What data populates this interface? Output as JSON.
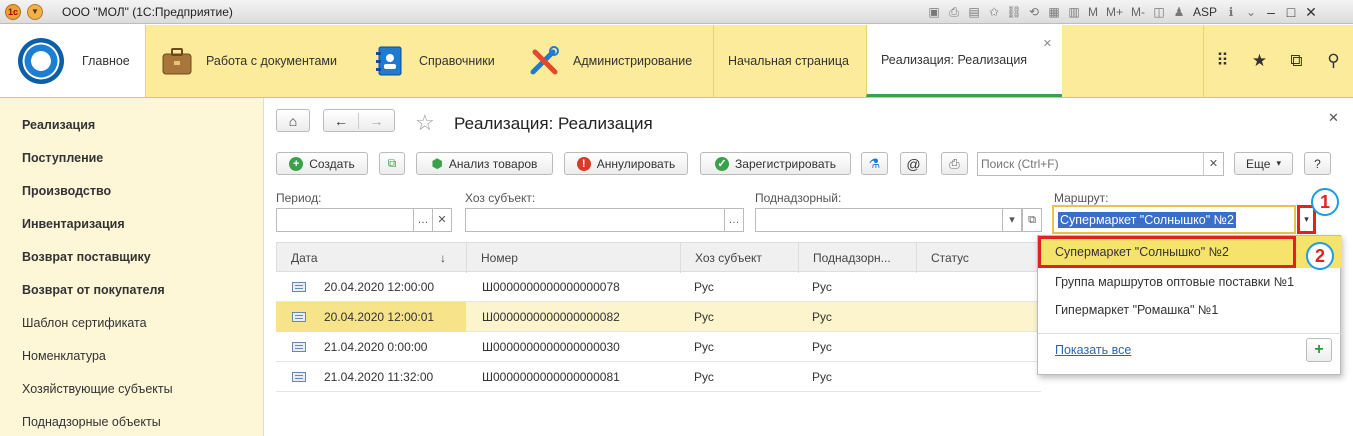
{
  "window": {
    "title": "ООО \"МОЛ\" (1С:Предприятие)",
    "user": "ASP",
    "toolbar_letters": [
      "M",
      "M+",
      "M-"
    ]
  },
  "sections": {
    "home": "Главное",
    "docs": "Работа с документами",
    "refs": "Справочники",
    "admin": "Администрирование"
  },
  "tabs": {
    "start": "Начальная страница",
    "active": "Реализация: Реализация"
  },
  "sidebar": {
    "items": [
      {
        "label": "Реализация",
        "bold": true
      },
      {
        "label": "Поступление",
        "bold": true
      },
      {
        "label": "Производство",
        "bold": true
      },
      {
        "label": "Инвентаризация",
        "bold": true
      },
      {
        "label": "Возврат поставщику",
        "bold": true
      },
      {
        "label": "Возврат от покупателя",
        "bold": true
      },
      {
        "label": "Шаблон сертификата",
        "bold": false
      },
      {
        "label": "Номенклатура",
        "bold": false
      },
      {
        "label": "Хозяйствующие субъекты",
        "bold": false
      },
      {
        "label": "Поднадзорные объекты",
        "bold": false
      }
    ]
  },
  "form": {
    "title": "Реализация: Реализация",
    "toolbar": {
      "create": "Создать",
      "analysis": "Анализ товаров",
      "cancel": "Аннулировать",
      "register": "Зарегистрировать",
      "at": "@",
      "more": "Еще",
      "help": "?"
    },
    "search": {
      "placeholder": "Поиск (Ctrl+F)"
    },
    "filters": {
      "period_label": "Период:",
      "entity_label": "Хоз субъект:",
      "supervised_label": "Поднадзорный:",
      "route_label": "Маршрут:",
      "route_value": "Супермаркет \"Солнышко\" №2"
    },
    "table": {
      "columns": [
        "Дата",
        "Номер",
        "Хоз субъект",
        "Поднадзорн...",
        "Статус"
      ],
      "sort_indicator": "↓",
      "rows": [
        {
          "date": "20.04.2020 12:00:00",
          "number": "Ш0000000000000000078",
          "entity": "Рус",
          "supervised": "Рус"
        },
        {
          "date": "20.04.2020 12:00:01",
          "number": "Ш0000000000000000082",
          "entity": "Рус",
          "supervised": "Рус"
        },
        {
          "date": "21.04.2020 0:00:00",
          "number": "Ш0000000000000000030",
          "entity": "Рус",
          "supervised": "Рус"
        },
        {
          "date": "21.04.2020 11:32:00",
          "number": "Ш0000000000000000081",
          "entity": "Рус",
          "supervised": "Рус"
        }
      ]
    }
  },
  "dropdown": {
    "items": [
      "Супермаркет \"Солнышко\" №2",
      "Группа маршрутов оптовые поставки №1",
      "Гипермаркет \"Ромашка\" №1"
    ],
    "show_all": "Показать все",
    "add": "+"
  },
  "annotations": {
    "badge1": "1",
    "badge2": "2"
  },
  "colors": {
    "section_bar": "#fbeb9a",
    "sidebar_bg": "#fdf7d7",
    "highlight": "#f6e36b",
    "annotation_red": "#e0231f",
    "annotation_blue": "#1e9be5"
  }
}
